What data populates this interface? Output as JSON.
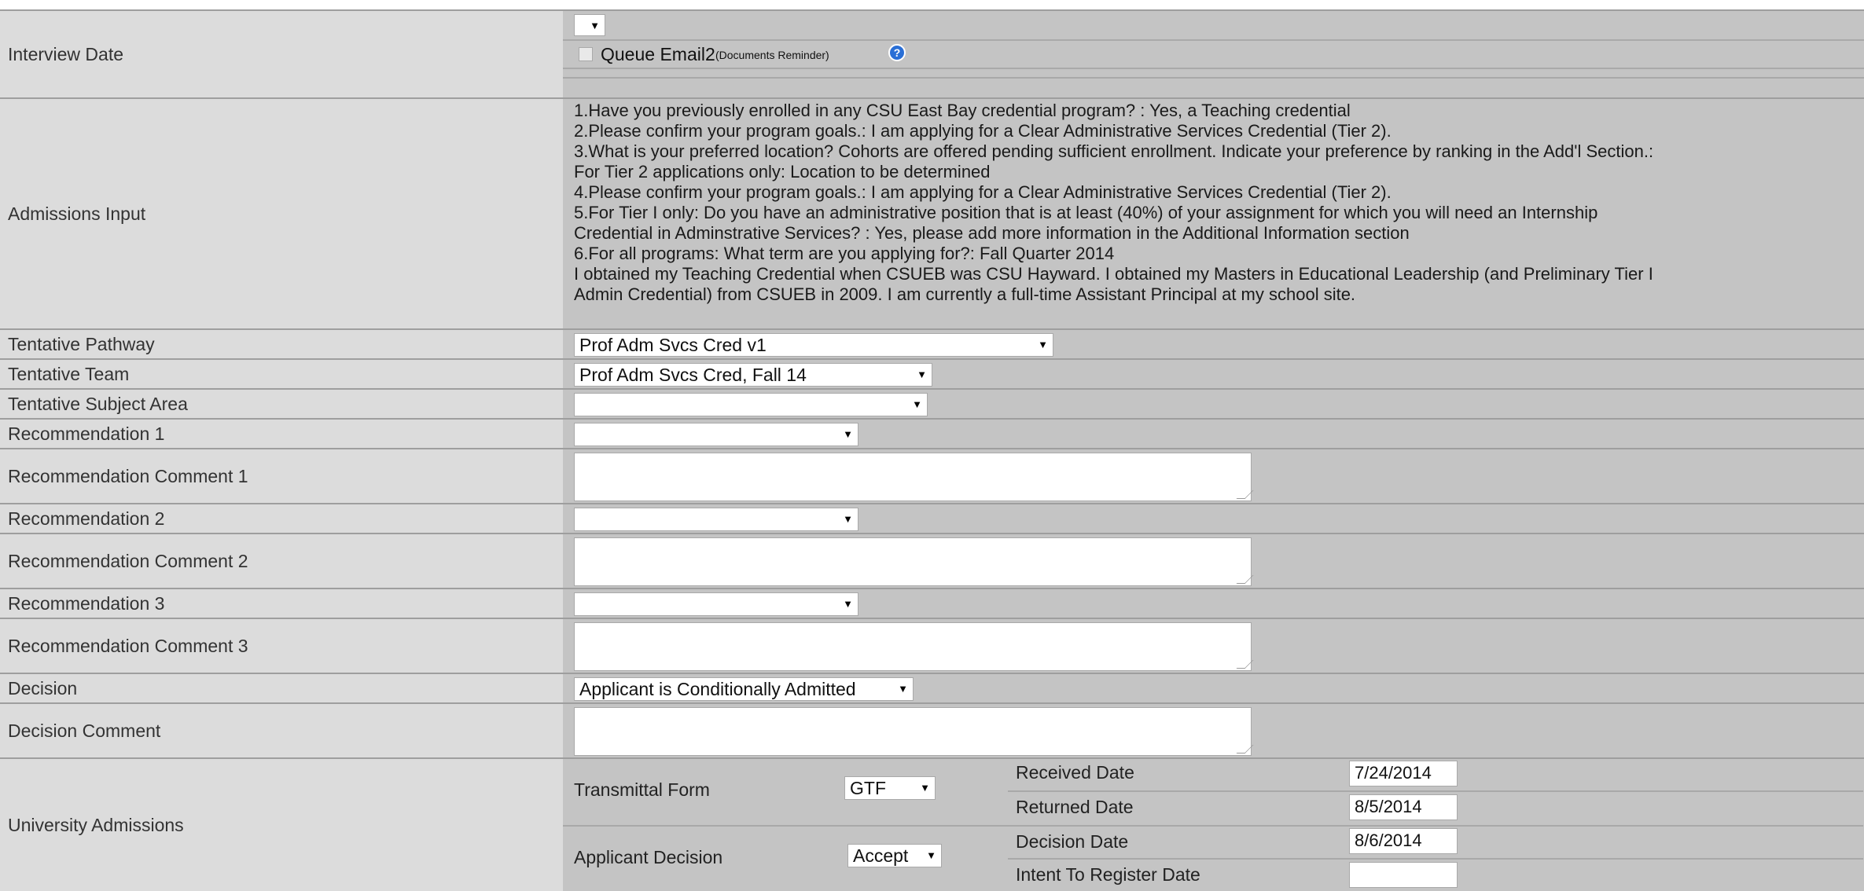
{
  "interview_date": {
    "label": "Interview Date",
    "select_value": "",
    "queue_email_label": "Queue Email2",
    "queue_email_note": "(Documents Reminder)",
    "queue_email_checked": false,
    "help_icon": "help-circle-icon"
  },
  "admissions_input": {
    "label": "Admissions Input",
    "lines": [
      "1.Have you previously enrolled in any CSU East Bay credential program? : Yes, a Teaching credential",
      "2.Please confirm your program goals.: I am applying for a Clear Administrative Services Credential (Tier 2).",
      "3.What is your preferred location? Cohorts are offered pending sufficient enrollment. Indicate your preference by ranking in the Add'l Section.:",
      "For Tier 2 applications only: Location to be determined",
      "4.Please confirm your program goals.: I am applying for a Clear Administrative Services Credential (Tier 2).",
      "5.For Tier I only: Do you have an administrative position that is at least (40%) of your assignment for which you will need an Internship",
      "Credential in Adminstrative Services? : Yes, please add more information in the Additional Information section",
      "6.For all programs: What term are you applying for?: Fall Quarter 2014",
      "I obtained my Teaching Credential when CSUEB was CSU Hayward. I obtained my Masters in Educational Leadership (and Preliminary Tier I",
      "Admin Credential) from CSUEB in 2009. I am currently a full-time Assistant Principal at my school site."
    ]
  },
  "tentative_pathway": {
    "label": "Tentative Pathway",
    "value": "Prof Adm Svcs Cred v1"
  },
  "tentative_team": {
    "label": "Tentative Team",
    "value": "Prof Adm Svcs Cred, Fall 14"
  },
  "tentative_subject_area": {
    "label": "Tentative Subject Area",
    "value": ""
  },
  "recommendation_1": {
    "label": "Recommendation 1",
    "value": ""
  },
  "recommendation_comment_1": {
    "label": "Recommendation Comment 1",
    "value": ""
  },
  "recommendation_2": {
    "label": "Recommendation 2",
    "value": ""
  },
  "recommendation_comment_2": {
    "label": "Recommendation Comment 2",
    "value": ""
  },
  "recommendation_3": {
    "label": "Recommendation 3",
    "value": ""
  },
  "recommendation_comment_3": {
    "label": "Recommendation Comment 3",
    "value": ""
  },
  "decision": {
    "label": "Decision",
    "value": "Applicant is Conditionally Admitted"
  },
  "decision_comment": {
    "label": "Decision Comment",
    "value": ""
  },
  "university_admissions": {
    "label": "University Admissions",
    "transmittal_form": {
      "label": "Transmittal Form",
      "value": "GTF"
    },
    "applicant_decision": {
      "label": "Applicant Decision",
      "value": "Accept"
    },
    "received_date": {
      "label": "Received Date",
      "value": "7/24/2014"
    },
    "returned_date": {
      "label": "Returned Date",
      "value": "8/5/2014"
    },
    "decision_date": {
      "label": "Decision Date",
      "value": "8/6/2014"
    },
    "intent_to_register_date": {
      "label": "Intent To Register Date",
      "value": ""
    }
  },
  "colors": {
    "label_bg": "#dcdcdc",
    "value_bg": "#c4c4c4",
    "border": "#9e9e9e",
    "help_icon": "#2a6fd6"
  }
}
